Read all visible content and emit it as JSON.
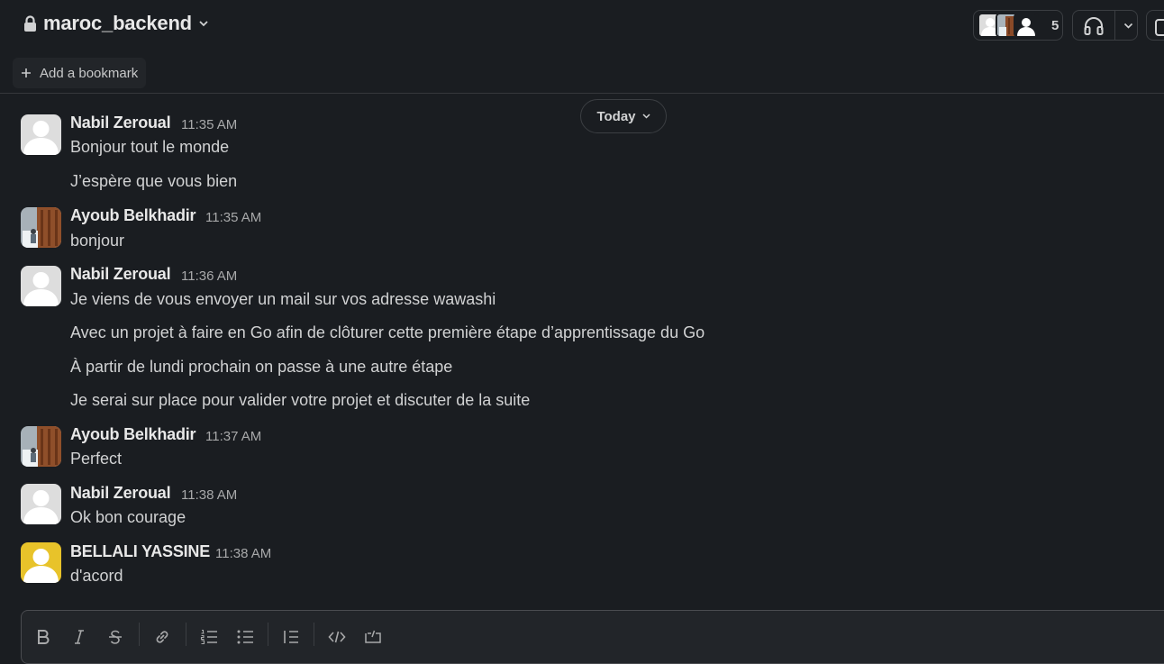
{
  "channel": {
    "name": "maroc_backend"
  },
  "header": {
    "bookmark_label": "Add a bookmark",
    "member_count": "5"
  },
  "date_divider": {
    "label": "Today"
  },
  "messages": [
    {
      "author": "Nabil Zeroual",
      "time": "11:35 AM",
      "lines": [
        "Bonjour tout le monde",
        "J’espère que vous bien"
      ]
    },
    {
      "author": "Ayoub Belkhadir",
      "time": "11:35 AM",
      "lines": [
        "bonjour"
      ]
    },
    {
      "author": "Nabil Zeroual",
      "time": "11:36 AM",
      "lines": [
        "Je viens de vous envoyer un mail sur vos adresse wawashi",
        "Avec un projet à faire en Go afin de clôturer cette première étape d’apprentissage du Go",
        "À partir de lundi prochain on passe à une autre étape",
        "Je serai sur place pour valider votre projet et discuter de la suite"
      ]
    },
    {
      "author": "Ayoub Belkhadir",
      "time": "11:37 AM",
      "lines": [
        "Perfect"
      ]
    },
    {
      "author": "Nabil Zeroual",
      "time": "11:38 AM",
      "lines": [
        "Ok bon courage"
      ]
    },
    {
      "author": "BELLALI YASSINE",
      "time": "11:38 AM",
      "lines": [
        "d'acord"
      ]
    }
  ],
  "colors": {
    "background": "#1a1d21",
    "default_avatar_bg": "#dddddd",
    "yellow_avatar_bg": "#e8c32a",
    "text_primary": "#d1d2d3",
    "text_muted": "#a8a9aa"
  },
  "toolbar_icons": [
    "bold-icon",
    "italic-icon",
    "strikethrough-icon",
    "link-icon",
    "ordered-list-icon",
    "bulleted-list-icon",
    "blockquote-icon",
    "code-icon",
    "code-block-icon"
  ]
}
